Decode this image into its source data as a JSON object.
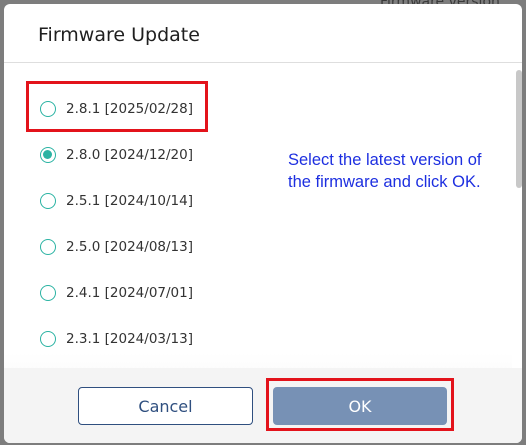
{
  "background": {
    "partial_text": "Firmware version"
  },
  "dialog": {
    "title": "Firmware Update",
    "options": [
      {
        "label": "2.8.1 [2025/02/28]",
        "selected": false
      },
      {
        "label": "2.8.0 [2024/12/20]",
        "selected": true
      },
      {
        "label": "2.5.1 [2024/10/14]",
        "selected": false
      },
      {
        "label": "2.5.0 [2024/08/13]",
        "selected": false
      },
      {
        "label": "2.4.1 [2024/07/01]",
        "selected": false
      },
      {
        "label": "2.3.1 [2024/03/13]",
        "selected": false
      }
    ],
    "note": "Select the latest version of the firmware and click OK.",
    "buttons": {
      "cancel": "Cancel",
      "ok": "OK"
    }
  },
  "colors": {
    "accent_radio": "#2bb3a3",
    "highlight": "#e3131b",
    "instruction_text": "#1d2fe0",
    "ok_button": "#7791b5",
    "cancel_border": "#2f4f7f"
  }
}
